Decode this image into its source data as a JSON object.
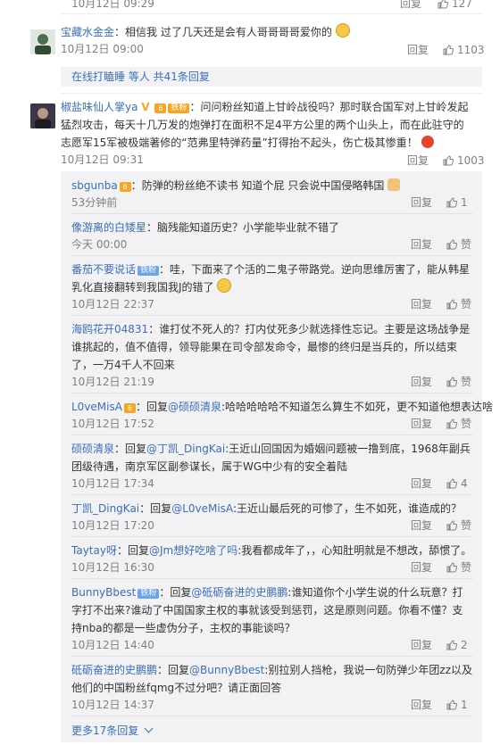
{
  "top_partial": {
    "date": "10月12日 09:29",
    "reply": "回复",
    "likes": "127"
  },
  "comments": [
    {
      "user": "宝藏水金金",
      "text": "相信我 过了几天还是会有人哥哥哥哥爱你的",
      "time": "10月12日 09:00",
      "reply": "回复",
      "likes": "1103"
    },
    {
      "user": "椒盐味仙人掌ya",
      "badge": "铁粉",
      "text": "问问粉丝知道上甘岭战役吗？那时联合国军对上甘岭发起猛烈攻击，每天十几万发的炮弹打在面积不足4平方公里的两个山头上，而在此驻守的志愿军15军被极端著修的“范弗里特弹药量”打得抬不起头，伤亡极其惨重！",
      "time": "10月12日 09:31",
      "reply": "回复",
      "likes": "1003"
    }
  ],
  "reply_summary": {
    "user": "在线打瞌睡",
    "text": "等人 共41条回复"
  },
  "replies": [
    {
      "user": "sbgunba",
      "text": "防弹的粉丝绝不读书 知道个屁 只会说中国侵略韩国",
      "time": "53分钟前",
      "reply": "回复",
      "likes": "1"
    },
    {
      "user": "像游离的白矮星",
      "text": "脑残能知道历史？小学能毕业就不错了",
      "time": "今天 00:00",
      "reply": "回复",
      "likes": "赞"
    },
    {
      "user": "番茄不要说话",
      "badge": "铁粉",
      "text": "哇，下面来了个活的二鬼子带路党。逆向思维厉害了，能从韩星乳化直接翻转到我国我J的错了",
      "time": "10月12日 22:37",
      "reply": "回复",
      "likes": "赞"
    },
    {
      "user": "海鸥花开04831",
      "text": "谁打仗不死人的？打内仗死多少就选择性忘记。主要是这场战争是谁挑起的，值不值得，领导能果在司令部发命令，最惨的终归是当兵的，所以结束了，一万4千人不回来",
      "time": "10月12日 21:19",
      "reply": "回复",
      "likes": "赞"
    },
    {
      "user": "L0veMisA",
      "prefix": "回复",
      "mention": "@硕硕清泉",
      "text": ":哈哈哈哈哈不知道怎么算生不如死，更不知道他想表达啥",
      "time": "10月12日 17:52",
      "reply": "回复",
      "likes": "赞"
    },
    {
      "user": "硕硕清泉",
      "prefix": "回复",
      "mention": "@丁凯_DingKai",
      "text": ":王近山回国因为婚姻问题被一撸到底，1968年副兵团级待遇，南京军区副参谋长，属于WG中少有的安全着陆",
      "time": "10月12日 17:34",
      "reply": "回复",
      "likes": "4"
    },
    {
      "user": "丁凯_DingKai",
      "prefix": "回复",
      "mention": "@L0veMisA",
      "text": ":王近山最后死的可惨了，生不如死，谁造成的？",
      "time": "10月12日 17:20",
      "reply": "回复",
      "likes": "赞"
    },
    {
      "user": "Taytay呀",
      "prefix": "回复",
      "mention": "@Jm想好吃啥了吗",
      "text": ":我看都成年了，，心知肚明就是不想改，舔惯了。",
      "time": "10月12日 16:30",
      "reply": "回复",
      "likes": "赞"
    },
    {
      "user": "BunnyBbest",
      "badge": "铁粉",
      "prefix": "回复",
      "mention": "@砥砺奋进的史鹏鹏",
      "text": ":谁知道你个小学生说的什么玩意？打字打不出来?谁动了中国国家主权的事就该受到惩罚，这是原则问题。你看不懂？支持nba的都是一些虚伪分子，主权的事能谈吗？",
      "time": "10月12日 14:40",
      "reply": "回复",
      "likes": "2"
    },
    {
      "user": "砥砺奋进的史鹏鹏",
      "prefix": "回复",
      "mention": "@BunnyBbest",
      "text": ":别拉别人挡枪，我说一句防弹少年团zz以及他们的中国粉丝fqmg不过分吧？请正面回答",
      "time": "10月12日 14:37",
      "reply": "回复",
      "likes": "1"
    }
  ],
  "more_replies": "更多17条回复",
  "colors": {
    "accent": "#eb7350",
    "link": "#3b6fb6",
    "panel": "#f2f2f5"
  }
}
